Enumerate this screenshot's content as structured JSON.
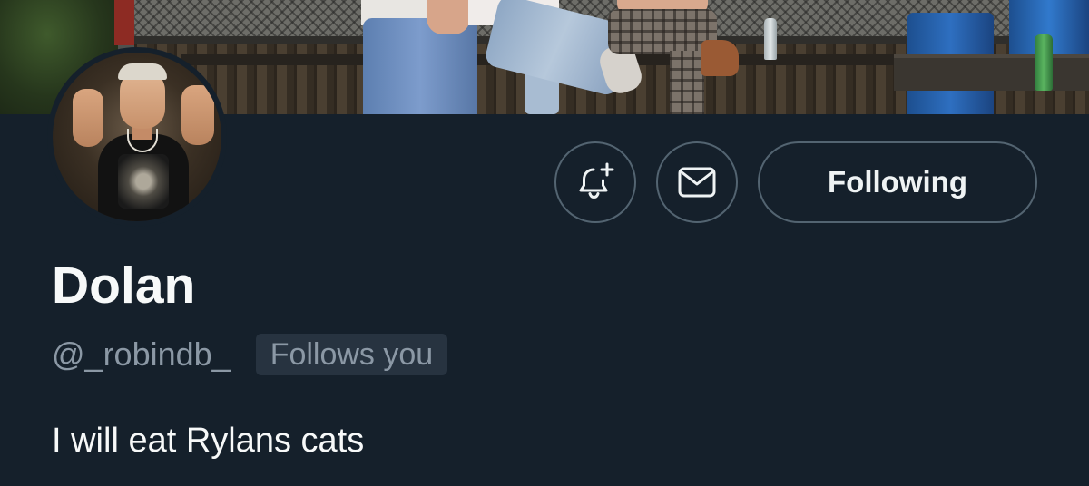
{
  "profile": {
    "display_name": "Dolan",
    "handle": "@_robindb_",
    "follows_you_label": "Follows you",
    "bio": "I will eat Rylans cats"
  },
  "actions": {
    "notify_icon": "bell-plus-icon",
    "message_icon": "envelope-icon",
    "following_label": "Following"
  },
  "colors": {
    "background": "#15202b",
    "secondary_text": "#8b98a5",
    "button_border": "#536471",
    "badge_background": "#273340"
  }
}
